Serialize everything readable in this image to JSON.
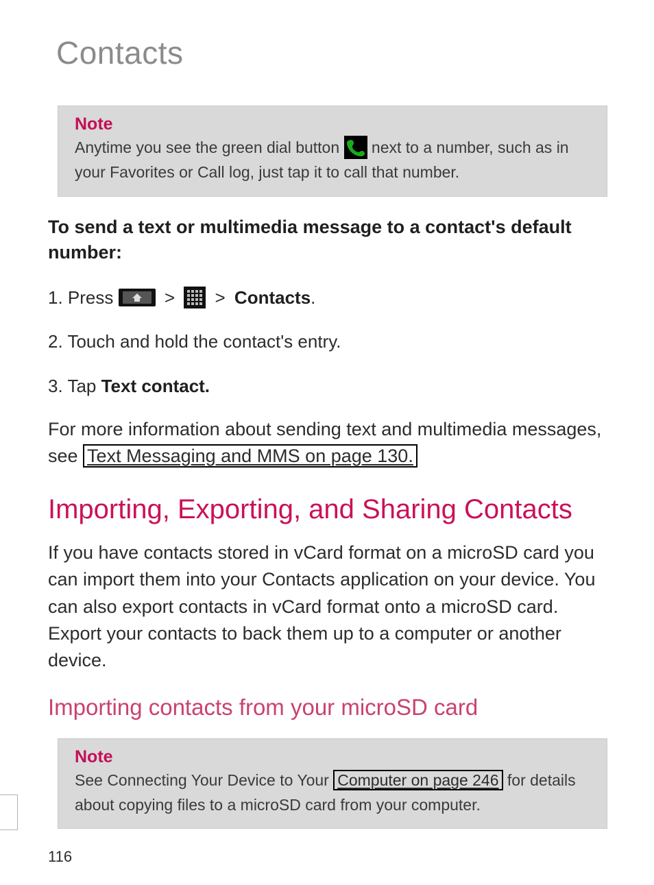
{
  "page_title": "Contacts",
  "note1": {
    "label": "Note",
    "text_before": "Anytime you see the green dial button ",
    "text_after": " next to a number, such as in your Favorites or Call log, just tap it to call that number."
  },
  "section1_title": "To send a text or multimedia message to a contact's default number:",
  "step1": {
    "num": "1.",
    "press": "Press ",
    "sep1": " > ",
    "sep2": " > ",
    "contacts": "Contacts",
    "dot": "."
  },
  "step2": {
    "num": "2.",
    "text": " Touch and hold the contact's entry."
  },
  "step3": {
    "num": "3.",
    "pre": " Tap ",
    "bold": "Text contact."
  },
  "more_info": {
    "pre": "For more information about sending text and multimedia messages, see ",
    "link": "Text Messaging and MMS on page 130."
  },
  "h1": "Importing, Exporting, and Sharing Contacts",
  "para1": "If you have contacts stored in vCard format on a microSD card you can import them into your Contacts application on your device. You can also export contacts in vCard format onto a microSD card. Export your contacts to back them up to a computer or another device.",
  "h2": "Importing contacts from your microSD card",
  "note2": {
    "label": "Note",
    "pre": "See Connecting Your Device to Your ",
    "link": "Computer on page 246",
    "post": " for details about copying files to a microSD card from your computer."
  },
  "page_number": "116"
}
